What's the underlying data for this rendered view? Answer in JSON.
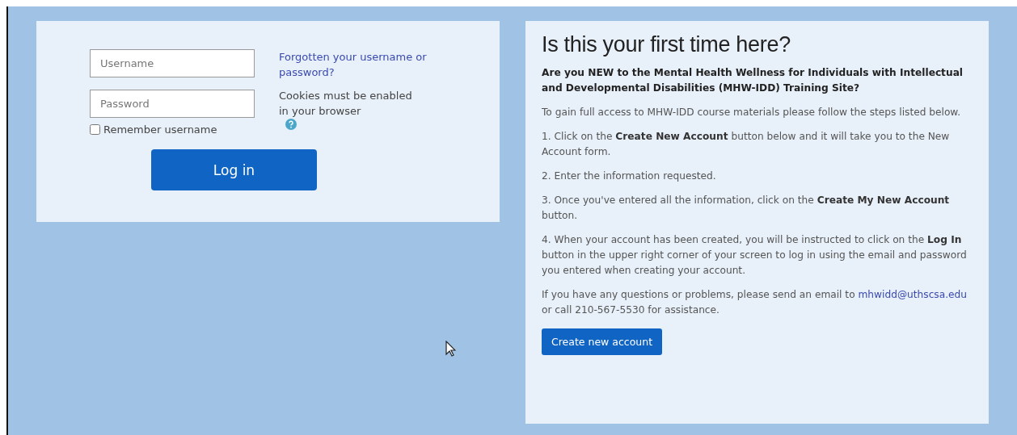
{
  "login": {
    "username": {
      "placeholder": "Username"
    },
    "password": {
      "placeholder": "Password"
    },
    "remember": {
      "label": "Remember username",
      "checked": false
    },
    "forgot_link": "Forgotten your username or password?",
    "cookies_note": "Cookies must be enabled in your browser",
    "login_button": "Log in"
  },
  "signup": {
    "title": "Is this your first time here?",
    "intro": "Are you NEW to the Mental Health Wellness for Individuals with Intellectual and Developmental Disabilities (MHW-IDD) Training Site?",
    "paragraphs": [
      "To gain full access to MHW-IDD course materials please follow the steps listed below.",
      "1. Click on the **Create New Account** button below and it will take you to the New Account form.",
      "2. Enter the information requested.",
      "3. Once you've entered all the information, click on the **Create My New Account** button.",
      "4. When your account has been created, you will be instructed to click on the **Log In** button in the upper right corner of your screen to log in using the email and password you entered when creating your account."
    ],
    "contact": {
      "before": "If you have any questions or problems, please send an email to",
      "email": "mhwidd@uthscsa.edu",
      "after": "or call 210-567-5530 for assistance."
    },
    "button": "Create new account"
  }
}
